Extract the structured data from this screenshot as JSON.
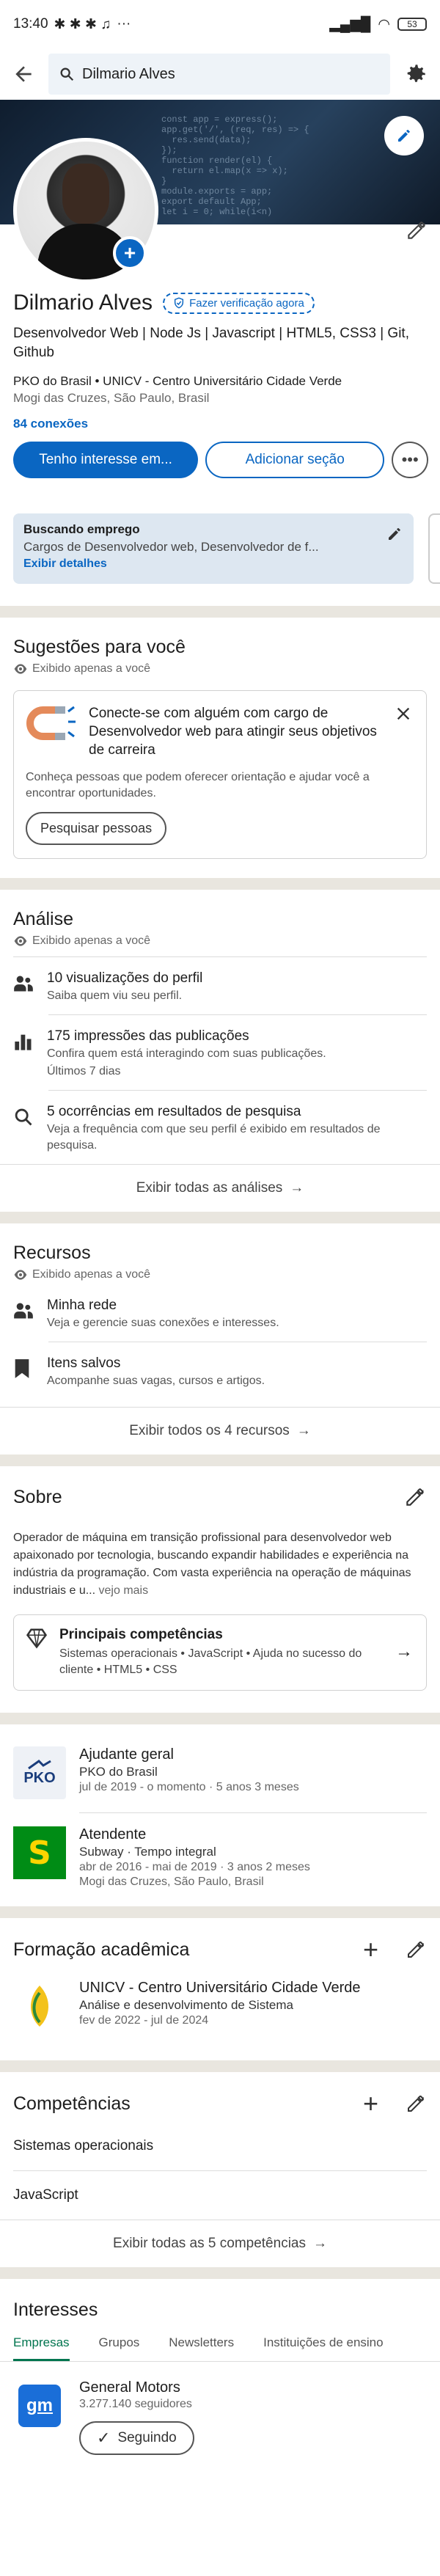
{
  "status": {
    "time": "13:40",
    "dots": "···",
    "battery": "53"
  },
  "search": {
    "value": "Dilmario Alves"
  },
  "profile": {
    "name": "Dilmario Alves",
    "verify_label": "Fazer verificação agora",
    "headline": "Desenvolvedor Web | Node Js | Javascript | HTML5, CSS3 | Git, Github",
    "education": "PKO do Brasil • UNICV - Centro Universitário Cidade Verde",
    "location": "Mogi das Cruzes, São Paulo, Brasil",
    "connections": "84 conexões",
    "btn_open": "Tenho interesse em...",
    "btn_add": "Adicionar seção"
  },
  "open_to": {
    "title": "Buscando emprego",
    "desc": "Cargos de Desenvolvedor web, Desenvolvedor de f...",
    "link": "Exibir detalhes"
  },
  "suggestions": {
    "title": "Sugestões para você",
    "private": "Exibido apenas a você",
    "card_text": "Conecte-se com alguém com cargo de Desenvolvedor web para atingir seus objetivos de carreira",
    "card_sub": "Conheça pessoas que podem oferecer orientação e ajudar você a encontrar oportunidades.",
    "button": "Pesquisar pessoas"
  },
  "analytics": {
    "title": "Análise",
    "private": "Exibido apenas a você",
    "items": [
      {
        "title": "10 visualizações do perfil",
        "sub": "Saiba quem viu seu perfil."
      },
      {
        "title": "175 impressões das publicações",
        "sub": "Confira quem está interagindo com suas publicações.",
        "sub2": "Últimos 7 dias"
      },
      {
        "title": "5 ocorrências em resultados de pesquisa",
        "sub": "Veja a frequência com que seu perfil é exibido em resultados de pesquisa."
      }
    ],
    "footer": "Exibir todas as análises"
  },
  "resources": {
    "title": "Recursos",
    "private": "Exibido apenas a você",
    "items": [
      {
        "title": "Minha rede",
        "sub": "Veja e gerencie suas conexões e interesses."
      },
      {
        "title": "Itens salvos",
        "sub": "Acompanhe suas vagas, cursos e artigos."
      }
    ],
    "footer": "Exibir todos os 4 recursos"
  },
  "about": {
    "title": "Sobre",
    "text": "Operador de máquina em transição profissional para desenvolvedor web apaixonado por tecnologia, buscando expandir habilidades e experiência na indústria da programação. Com vasta experiência na operação de máquinas industriais e u...",
    "more": "vejo mais",
    "skills_title": "Principais competências",
    "skills_text": "Sistemas operacionais • JavaScript • Ajuda no sucesso do cliente • HTML5 • CSS"
  },
  "experience": [
    {
      "logo": "PKO",
      "title": "Ajudante geral",
      "company": "PKO do Brasil",
      "dates": "jul de 2019 - o momento · 5 anos 3 meses"
    },
    {
      "logo": "S",
      "title": "Atendente",
      "company": "Subway · Tempo integral",
      "dates": "abr de 2016 - mai de 2019 · 3 anos 2 meses",
      "loc": "Mogi das Cruzes, São Paulo, Brasil"
    }
  ],
  "education_sec": {
    "title": "Formação acadêmica",
    "school": "UNICV - Centro Universitário Cidade Verde",
    "course": "Análise e desenvolvimento de Sistema",
    "dates": "fev de 2022 - jul de 2024"
  },
  "skills": {
    "title": "Competências",
    "items": [
      "Sistemas operacionais",
      "JavaScript"
    ],
    "footer": "Exibir todas as 5 competências"
  },
  "interests": {
    "title": "Interesses",
    "tabs": [
      "Empresas",
      "Grupos",
      "Newsletters",
      "Instituições de ensino"
    ],
    "company": "General Motors",
    "followers": "3.277.140 seguidores",
    "logo": "gm",
    "button": "Seguindo"
  },
  "colors": {
    "accent": "#0a66c2",
    "green": "#01754f",
    "subway": "#008c15",
    "subway_yellow": "#fcd400"
  }
}
